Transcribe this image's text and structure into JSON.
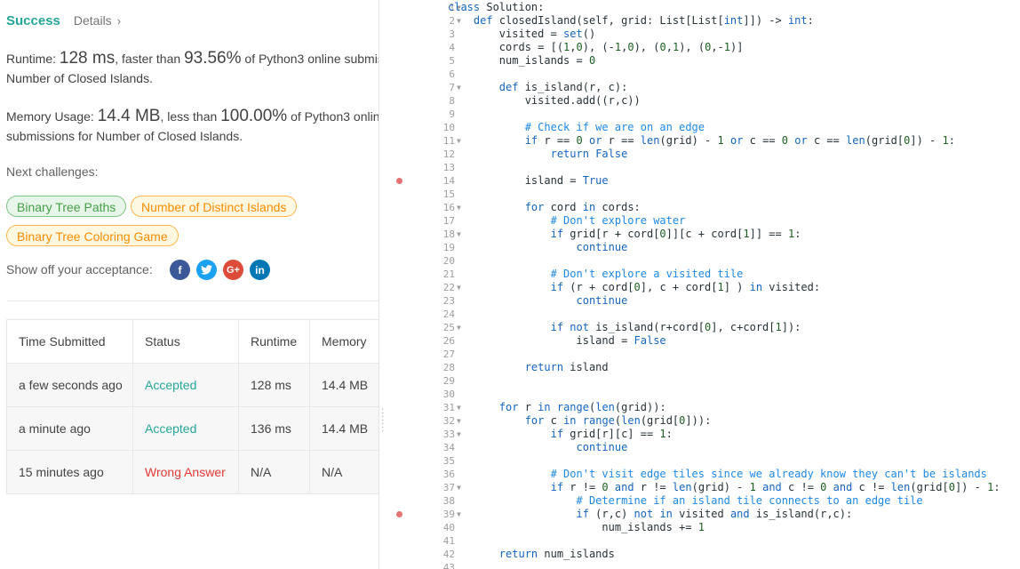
{
  "result": {
    "status": "Success",
    "details_label": "Details",
    "runtime_label": "Runtime:",
    "runtime_value": "128 ms",
    "runtime_mid": ", faster than",
    "runtime_pct": "93.56%",
    "runtime_tail": "of Python3 online submis",
    "runtime_line2": "Number of Closed Islands.",
    "memory_label": "Memory Usage:",
    "memory_value": "14.4 MB",
    "memory_mid": ", less than",
    "memory_pct": "100.00%",
    "memory_tail": "of Python3 onlin",
    "memory_line2": "submissions for Number of Closed Islands."
  },
  "next": {
    "label": "Next challenges:",
    "tags": [
      {
        "label": "Binary Tree Paths",
        "color": "#43a047"
      },
      {
        "label": "Number of Distinct Islands",
        "color": "#fb8c00"
      },
      {
        "label": "Binary Tree Coloring Game",
        "color": "#fb8c00"
      }
    ]
  },
  "share": {
    "label": "Show off your acceptance:",
    "icons": [
      {
        "name": "facebook-icon",
        "glyph": "f",
        "color": "#3b5998"
      },
      {
        "name": "twitter-icon",
        "glyph": "t",
        "color": "#1da1f2"
      },
      {
        "name": "google-plus-icon",
        "glyph": "G+",
        "color": "#dd4b39"
      },
      {
        "name": "linkedin-icon",
        "glyph": "in",
        "color": "#0077b5"
      }
    ]
  },
  "submissions": {
    "headers": [
      "Time Submitted",
      "Status",
      "Runtime",
      "Memory"
    ],
    "rows": [
      {
        "time": "a few seconds ago",
        "status": "Accepted",
        "runtime": "128 ms",
        "memory": "14.4 MB"
      },
      {
        "time": "a minute ago",
        "status": "Accepted",
        "runtime": "136 ms",
        "memory": "14.4 MB"
      },
      {
        "time": "15 minutes ago",
        "status": "Wrong Answer",
        "runtime": "N/A",
        "memory": "N/A"
      }
    ]
  },
  "editor": {
    "colors": {
      "keyword": "#1565c0",
      "number": "#1b5e20",
      "comment": "#1e88e5",
      "breakpoint": "#e57373"
    },
    "lines": [
      {
        "n": "1",
        "code": "class Solution:",
        "fold": true
      },
      {
        "n": "2",
        "code": "    def closedIsland(self, grid: List[List[int]]) -> int:",
        "fold": true
      },
      {
        "n": "3",
        "code": "        visited = set()"
      },
      {
        "n": "4",
        "code": "        cords = [(1,0), (-1,0), (0,1), (0,-1)]"
      },
      {
        "n": "5",
        "code": "        num_islands = 0"
      },
      {
        "n": "6",
        "code": ""
      },
      {
        "n": "7",
        "code": "        def is_island(r, c):",
        "fold": true
      },
      {
        "n": "8",
        "code": "            visited.add((r,c))"
      },
      {
        "n": "9",
        "code": ""
      },
      {
        "n": "10",
        "code": "            # Check if we are on an edge"
      },
      {
        "n": "11",
        "code": "            if r == 0 or r == len(grid) - 1 or c == 0 or c == len(grid[0]) - 1:",
        "fold": true
      },
      {
        "n": "12",
        "code": "                return False"
      },
      {
        "n": "13",
        "code": ""
      },
      {
        "n": "14",
        "code": "            island = True",
        "bp": true
      },
      {
        "n": "15",
        "code": ""
      },
      {
        "n": "16",
        "code": "            for cord in cords:",
        "fold": true
      },
      {
        "n": "17",
        "code": "                # Don't explore water"
      },
      {
        "n": "18",
        "code": "                if grid[r + cord[0]][c + cord[1]] == 1:",
        "fold": true
      },
      {
        "n": "19",
        "code": "                    continue"
      },
      {
        "n": "20",
        "code": ""
      },
      {
        "n": "21",
        "code": "                # Don't explore a visited tile"
      },
      {
        "n": "22",
        "code": "                if (r + cord[0], c + cord[1] ) in visited:",
        "fold": true
      },
      {
        "n": "23",
        "code": "                    continue"
      },
      {
        "n": "24",
        "code": ""
      },
      {
        "n": "25",
        "code": "                if not is_island(r+cord[0], c+cord[1]):",
        "fold": true
      },
      {
        "n": "26",
        "code": "                    island = False"
      },
      {
        "n": "27",
        "code": ""
      },
      {
        "n": "28",
        "code": "            return island"
      },
      {
        "n": "29",
        "code": ""
      },
      {
        "n": "30",
        "code": ""
      },
      {
        "n": "31",
        "code": "        for r in range(len(grid)):",
        "fold": true
      },
      {
        "n": "32",
        "code": "            for c in range(len(grid[0])):",
        "fold": true
      },
      {
        "n": "33",
        "code": "                if grid[r][c] == 1:",
        "fold": true
      },
      {
        "n": "34",
        "code": "                    continue"
      },
      {
        "n": "35",
        "code": ""
      },
      {
        "n": "36",
        "code": "                # Don't visit edge tiles since we already know they can't be islands"
      },
      {
        "n": "37",
        "code": "                if r != 0 and r != len(grid) - 1 and c != 0 and c != len(grid[0]) - 1:",
        "fold": true
      },
      {
        "n": "38",
        "code": "                    # Determine if an island tile connects to an edge tile"
      },
      {
        "n": "39",
        "code": "                    if (r,c) not in visited and is_island(r,c):",
        "fold": true,
        "bp": true
      },
      {
        "n": "40",
        "code": "                        num_islands += 1"
      },
      {
        "n": "41",
        "code": ""
      },
      {
        "n": "42",
        "code": "        return num_islands"
      },
      {
        "n": "43",
        "code": ""
      }
    ]
  }
}
